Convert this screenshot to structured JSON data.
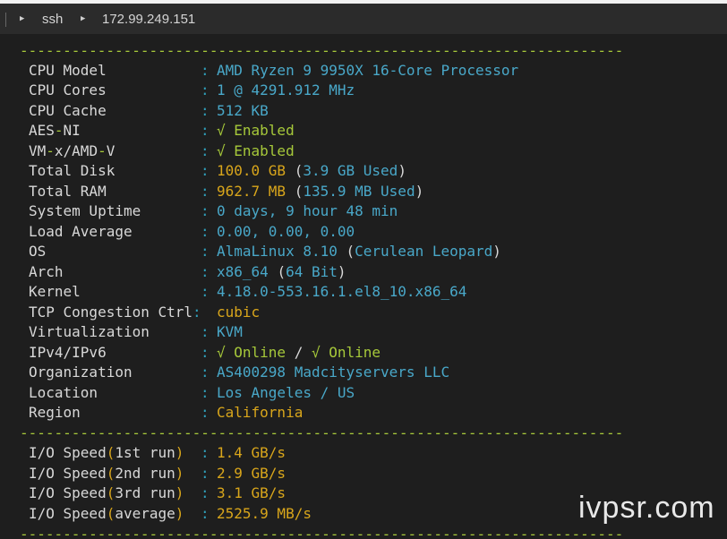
{
  "breadcrumb": {
    "item1": "ssh",
    "item2": "172.99.249.151"
  },
  "separator": "----------------------------------------------------------------------",
  "sysinfo": {
    "cpu_model": {
      "label": "CPU Model",
      "value": "AMD Ryzen 9 9950X 16-Core Processor"
    },
    "cpu_cores": {
      "label": "CPU Cores",
      "value": "1 @ 4291.912 MHz"
    },
    "cpu_cache": {
      "label": "CPU Cache",
      "value": "512 KB"
    },
    "aes_ni": {
      "label_a": "AES",
      "label_b": "-",
      "label_c": "NI",
      "value": "√ Enabled"
    },
    "vmx": {
      "label_a": "VM",
      "label_b": "-",
      "label_c": "x/AMD",
      "label_d": "-",
      "label_e": "V",
      "value": "√ Enabled"
    },
    "total_disk": {
      "label": "Total Disk",
      "value": "100.0 GB",
      "paren_open": "(",
      "used": "3.9 GB Used",
      "paren_close": ")"
    },
    "total_ram": {
      "label": "Total RAM",
      "value": "962.7 MB",
      "paren_open": "(",
      "used": "135.9 MB Used",
      "paren_close": ")"
    },
    "uptime": {
      "label": "System Uptime",
      "value": "0 days, 9 hour 48 min"
    },
    "load": {
      "label": "Load Average",
      "value": "0.00, 0.00, 0.00"
    },
    "os": {
      "label": "OS",
      "value": "AlmaLinux 8.10",
      "paren_open": "(",
      "detail": "Cerulean Leopard",
      "paren_close": ")"
    },
    "arch": {
      "label": "Arch",
      "value": "x86_64",
      "paren_open": "(",
      "detail": "64 Bit",
      "paren_close": ")"
    },
    "kernel": {
      "label": "Kernel",
      "value": "4.18.0-553.16.1.el8_10.x86_64"
    },
    "tcp": {
      "label": "TCP Congestion Ctrl",
      "value": "cubic"
    },
    "virt": {
      "label": "Virtualization",
      "value": "KVM"
    },
    "ipv": {
      "label": "IPv4/IPv6",
      "v4": "√ Online",
      "slash": "/",
      "v6": "√ Online"
    },
    "org": {
      "label": "Organization",
      "value": "AS400298 Madcityservers LLC"
    },
    "location": {
      "label": "Location",
      "value": "Los Angeles / US"
    },
    "region": {
      "label": "Region",
      "value": "California"
    }
  },
  "io": {
    "run1": {
      "label_a": "I/O Speed",
      "paren_open": "(",
      "label_b": "1st run",
      "paren_close": ")",
      "value": "1.4 GB/s"
    },
    "run2": {
      "label_a": "I/O Speed",
      "paren_open": "(",
      "label_b": "2nd run",
      "paren_close": ")",
      "value": "2.9 GB/s"
    },
    "run3": {
      "label_a": "I/O Speed",
      "paren_open": "(",
      "label_b": "3rd run",
      "paren_close": ")",
      "value": "3.1 GB/s"
    },
    "avg": {
      "label_a": "I/O Speed",
      "paren_open": "(",
      "label_b": "average",
      "paren_close": ")",
      "value": "2525.9 MB/s"
    }
  },
  "colon": ":",
  "watermark": "ivpsr.com",
  "icons": {
    "breadcrumb_arrow": "play-arrow-icon"
  },
  "colors": {
    "cyan": "#49a8c9",
    "yellow": "#d9a61b",
    "green": "#a6c83a",
    "background": "#1e1e1e"
  }
}
